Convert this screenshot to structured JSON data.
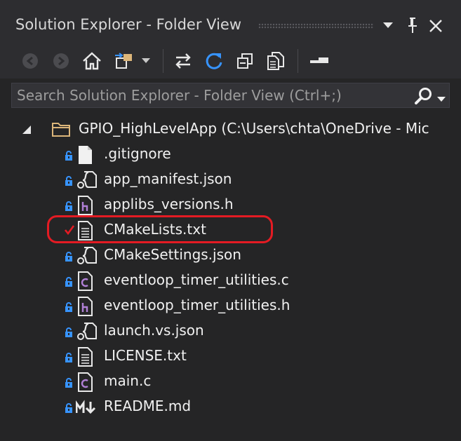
{
  "window": {
    "title": "Solution Explorer - Folder View"
  },
  "search": {
    "placeholder": "Search Solution Explorer - Folder View (Ctrl+;)"
  },
  "tree": {
    "root": {
      "label": "GPIO_HighLevelApp (C:\\Users\\chta\\OneDrive - Mic",
      "icon": "folder-icon"
    },
    "items": [
      {
        "label": ".gitignore",
        "icon": "text-file-icon",
        "status": "lock"
      },
      {
        "label": "app_manifest.json",
        "icon": "json-file-icon",
        "status": "lock"
      },
      {
        "label": "applibs_versions.h",
        "icon": "header-file-icon",
        "status": "lock"
      },
      {
        "label": "CMakeLists.txt",
        "icon": "text-file-icon",
        "status": "checked-out"
      },
      {
        "label": "CMakeSettings.json",
        "icon": "json-file-icon",
        "status": "lock"
      },
      {
        "label": "eventloop_timer_utilities.c",
        "icon": "c-file-icon",
        "status": "lock"
      },
      {
        "label": "eventloop_timer_utilities.h",
        "icon": "header-file-icon",
        "status": "lock"
      },
      {
        "label": "launch.vs.json",
        "icon": "json-file-icon",
        "status": "lock"
      },
      {
        "label": "LICENSE.txt",
        "icon": "text-file-icon",
        "status": "lock"
      },
      {
        "label": "main.c",
        "icon": "c-file-icon",
        "status": "lock"
      },
      {
        "label": "README.md",
        "icon": "markdown-file-icon",
        "status": "lock"
      }
    ]
  },
  "colors": {
    "background": "#252526",
    "toolbar": "#2d2d30",
    "accent": "#3794ff",
    "highlight": "#e41b23",
    "c_file": "#b180d7"
  }
}
